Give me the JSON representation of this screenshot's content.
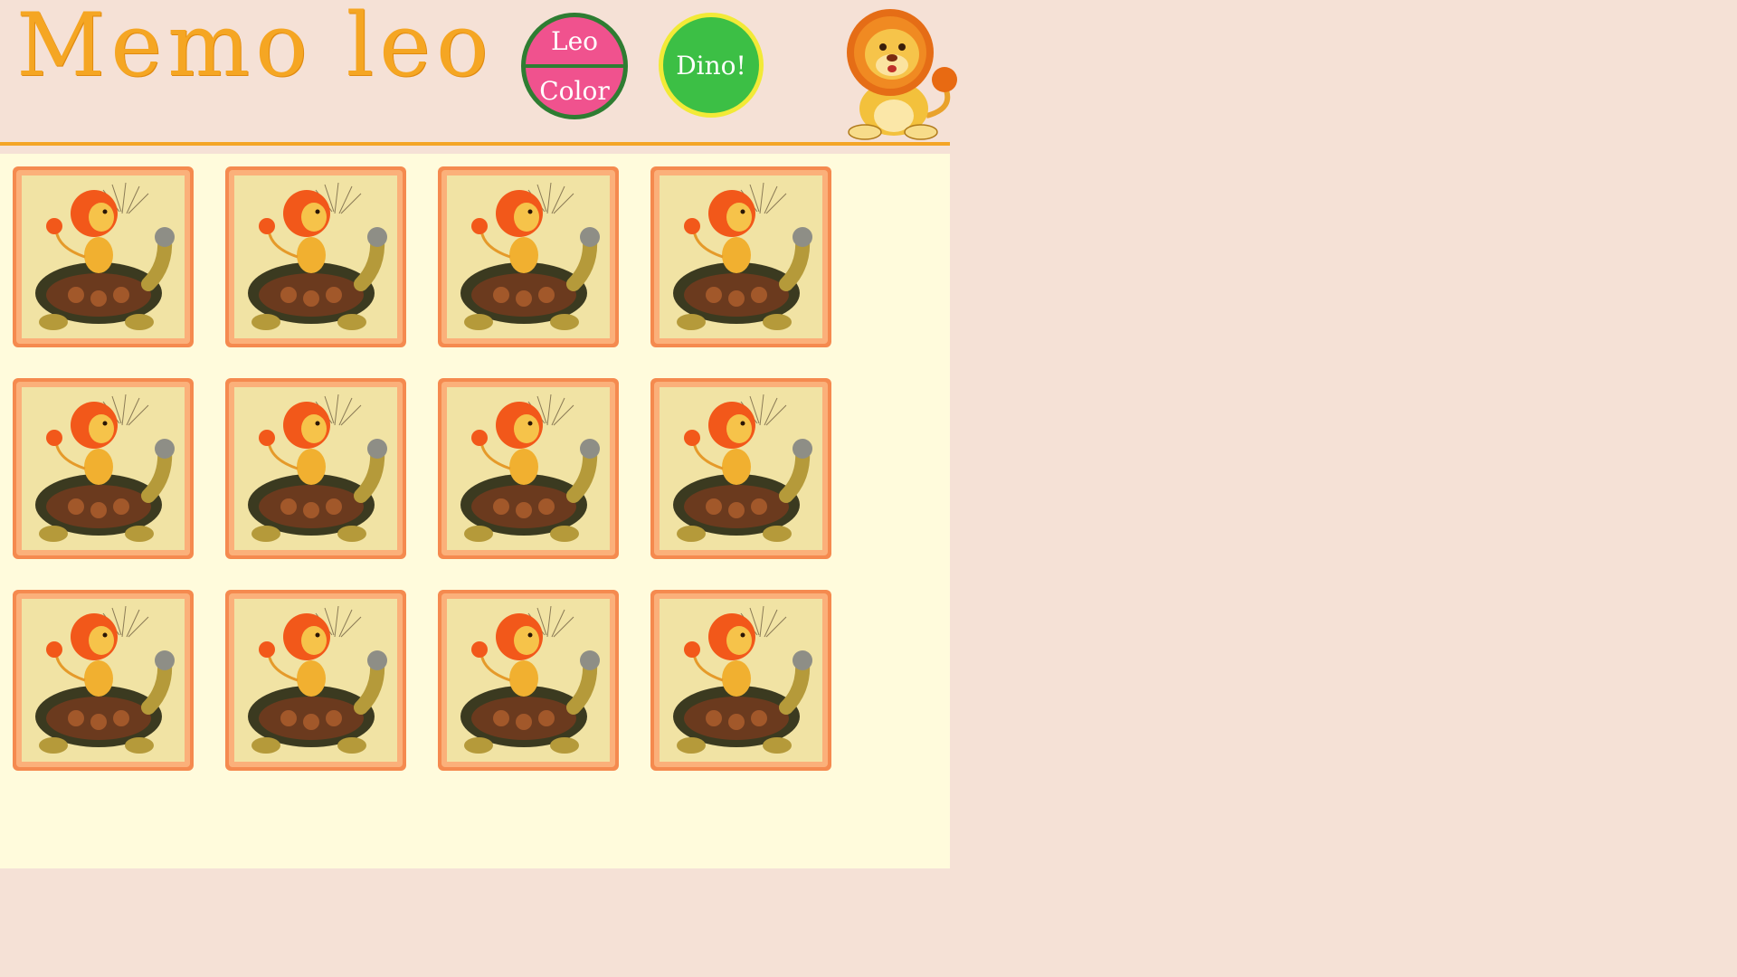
{
  "header": {
    "logo_text": "Memo leo",
    "buttons": [
      {
        "label_top": "Leo",
        "label_bottom": "Color"
      },
      {
        "label": "Dino!"
      }
    ],
    "mascot_icon": "lion-mascot-icon"
  },
  "board": {
    "rows": 3,
    "columns": 4,
    "card_back_icon": "lion-on-turtle-card-back",
    "cards": [
      {
        "state": "face-down"
      },
      {
        "state": "face-down"
      },
      {
        "state": "face-down"
      },
      {
        "state": "face-down"
      },
      {
        "state": "face-down"
      },
      {
        "state": "face-down"
      },
      {
        "state": "face-down"
      },
      {
        "state": "face-down"
      },
      {
        "state": "face-down"
      },
      {
        "state": "face-down"
      },
      {
        "state": "face-down"
      },
      {
        "state": "face-down"
      }
    ]
  },
  "colors": {
    "page_background": "#f5e1d6",
    "board_background": "#fffbdc",
    "logo": "#f5a623",
    "header_line": "#f4a526",
    "leocolor_button": "#f0528e",
    "leocolor_border": "#2e7d32",
    "dino_button": "#3cbf45",
    "dino_border": "#f2ea37"
  }
}
